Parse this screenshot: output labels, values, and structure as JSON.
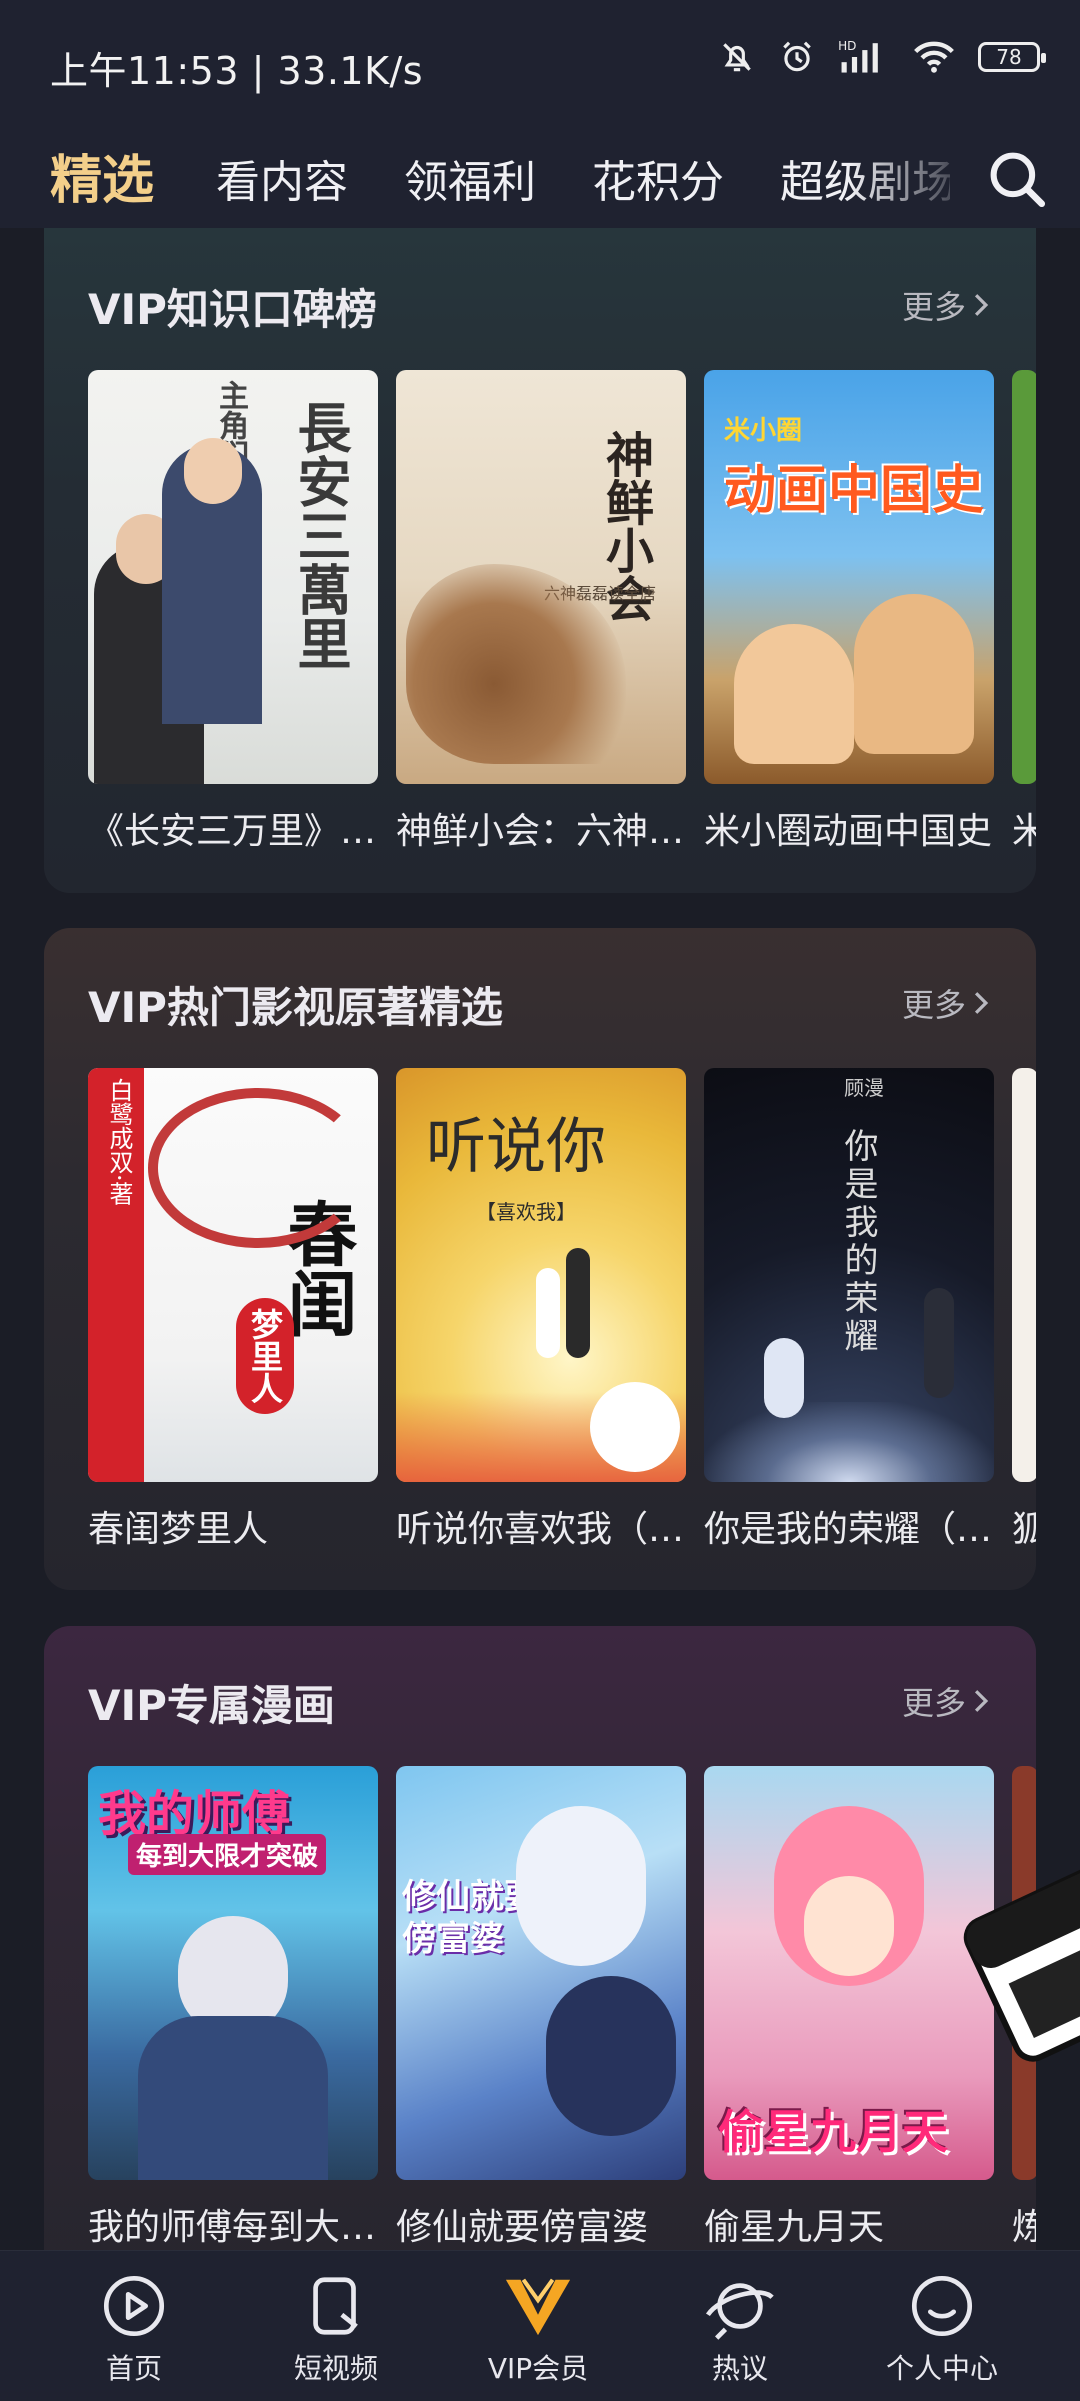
{
  "status": {
    "time_speed": "上午11:53 | 33.1K/s",
    "battery": "78",
    "network": "HD"
  },
  "top_nav": {
    "tabs": [
      "精选",
      "看内容",
      "领福利",
      "花积分",
      "超级剧场"
    ],
    "active_index": 0
  },
  "sections": [
    {
      "title": "VIP知识口碑榜",
      "more": "更多",
      "items": [
        {
          "title": "《长安三万里》主角们的诗酒人生",
          "cover_text": "長安三萬里",
          "cover_sub": "主角们的诗酒人生"
        },
        {
          "title": "神鲜小会：六神磊磊读全唐诗",
          "cover_text": "神鲜小会",
          "cover_sub": "六神磊磊读全唐"
        },
        {
          "title": "米小圈动画中国史",
          "cover_text": "动画中国史",
          "cover_sub": "米小圈"
        },
        {
          "title": "米"
        }
      ]
    },
    {
      "title": "VIP热门影视原著精选",
      "more": "更多",
      "items": [
        {
          "title": "春闺梦里人",
          "cover_text": "春闺",
          "cover_sub": "梦里人",
          "cover_author": "白鹭成双·著"
        },
        {
          "title": "听说你喜欢我（影视原著）",
          "cover_text": "听说你",
          "cover_sub": "【喜欢我】"
        },
        {
          "title": "你是我的荣耀（影视原著）",
          "cover_text": "你是我的荣耀",
          "cover_sub": "顾漫"
        },
        {
          "title": "狐"
        }
      ]
    },
    {
      "title": "VIP专属漫画",
      "more": "更多",
      "items": [
        {
          "title": "我的师傅每到大限才突破",
          "cover_text": "我的师傅",
          "cover_sub": "每到大限才突破"
        },
        {
          "title": "修仙就要傍富婆",
          "cover_text": "修仙就要傍富婆"
        },
        {
          "title": "偷星九月天",
          "cover_text": "偷星九月天"
        },
        {
          "title": "炼"
        }
      ]
    }
  ],
  "bottom_nav": {
    "items": [
      "首页",
      "短视频",
      "VIP会员",
      "热议",
      "个人中心"
    ],
    "active_index": 2
  },
  "colors": {
    "active_tab": "#f3cf8a",
    "vip_accent": "#f5a623"
  }
}
